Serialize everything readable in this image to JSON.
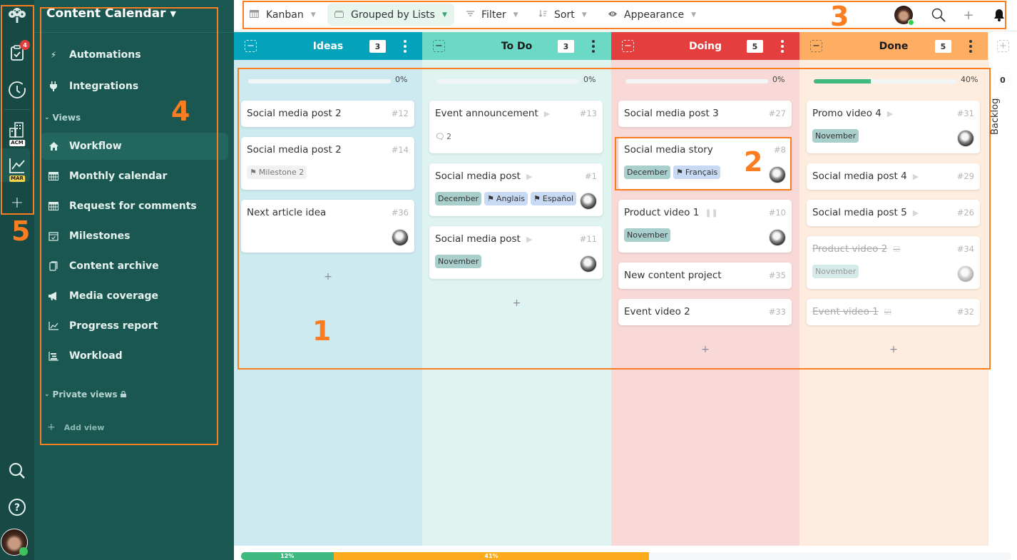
{
  "rail": {
    "notifications_badge": "4",
    "workspaces": [
      {
        "tag": "ACM",
        "tag_color": "#ffffff",
        "tag_text_color": "#1b1b1b"
      },
      {
        "tag": "MAR",
        "tag_color": "#f8d34a",
        "tag_text_color": "#1b1b1b"
      }
    ],
    "add_label": "+"
  },
  "sidebar": {
    "title": "Content Calendar",
    "top_items": [
      {
        "icon": "bolt-icon",
        "label": "Automations"
      },
      {
        "icon": "plug-icon",
        "label": "Integrations"
      }
    ],
    "views_section": "Views",
    "views": [
      {
        "icon": "home-icon",
        "label": "Workflow",
        "active": true
      },
      {
        "icon": "calendar-icon",
        "label": "Monthly calendar"
      },
      {
        "icon": "calendar-icon",
        "label": "Request for comments"
      },
      {
        "icon": "milestone-icon",
        "label": "Milestones"
      },
      {
        "icon": "archive-icon",
        "label": "Content archive"
      },
      {
        "icon": "megaphone-icon",
        "label": "Media coverage"
      },
      {
        "icon": "chart-icon",
        "label": "Progress report"
      },
      {
        "icon": "workload-icon",
        "label": "Workload"
      }
    ],
    "private_section": "Private views",
    "add_view": "Add view"
  },
  "toolbar": {
    "view": "Kanban",
    "grouping": "Grouped by Lists",
    "filter": "Filter",
    "sort": "Sort",
    "appearance": "Appearance"
  },
  "columns": [
    {
      "title": "Ideas",
      "count": "3",
      "progress": 0,
      "progress_label": "0%",
      "head_color": "#05a2bc",
      "bg_color": "#cceaef",
      "title_color": "#ffffff",
      "cards": [
        {
          "title": "Social media post 2",
          "num": "#12"
        },
        {
          "title": "Social media post 2",
          "num": "#14",
          "milestone": "Milestone 2"
        },
        {
          "title": "Next article idea",
          "num": "#36",
          "avatar": true
        }
      ]
    },
    {
      "title": "To Do",
      "count": "3",
      "progress": 0,
      "progress_label": "0%",
      "head_color": "#6bd9c6",
      "bg_color": "#dff4f1",
      "title_color": "#1a1a1a",
      "cards": [
        {
          "title": "Event announcement",
          "num": "#13",
          "play": true,
          "comments": "2"
        },
        {
          "title": "Social media post",
          "num": "#1",
          "play": true,
          "month": "December",
          "langs": [
            "Anglais",
            "Español"
          ],
          "avatar": true
        },
        {
          "title": "Social media post",
          "num": "#11",
          "play": true,
          "month": "November",
          "avatar": true
        }
      ]
    },
    {
      "title": "Doing",
      "count": "5",
      "progress": 0,
      "progress_label": "0%",
      "head_color": "#e53e3e",
      "bg_color": "#f8d9d8",
      "title_color": "#ffffff",
      "cards": [
        {
          "title": "Social media post 3",
          "num": "#27"
        },
        {
          "title": "Social media story",
          "num": "#8",
          "month": "December",
          "langs": [
            "Français"
          ],
          "avatar": true
        },
        {
          "title": "Product video 1",
          "num": "#10",
          "pause": true,
          "month": "November",
          "avatar": true
        },
        {
          "title": "New content project",
          "num": "#35"
        },
        {
          "title": "Event video 2",
          "num": "#33"
        }
      ]
    },
    {
      "title": "Done",
      "count": "5",
      "progress": 40,
      "progress_label": "40%",
      "head_color": "#fdae62",
      "bg_color": "#feeddf",
      "title_color": "#1a1a1a",
      "cards": [
        {
          "title": "Promo video 4",
          "num": "#31",
          "play": true,
          "month": "November",
          "avatar": true
        },
        {
          "title": "Social media post 4",
          "num": "#29",
          "play": true
        },
        {
          "title": "Social media post 5",
          "num": "#26",
          "play": true
        },
        {
          "title": "Product video 2",
          "num": "#34",
          "done": true,
          "month": "November",
          "avatar": true
        },
        {
          "title": "Event video 1",
          "num": "#32",
          "done": true
        }
      ]
    }
  ],
  "backlog": {
    "label": "Backlog",
    "count": "0"
  },
  "overall_progress": [
    {
      "label": "12%",
      "value": 12,
      "color": "#40b981"
    },
    {
      "label": "41%",
      "value": 41,
      "color": "#fbab1b"
    }
  ],
  "annotations": [
    "1",
    "2",
    "3",
    "4",
    "5"
  ]
}
